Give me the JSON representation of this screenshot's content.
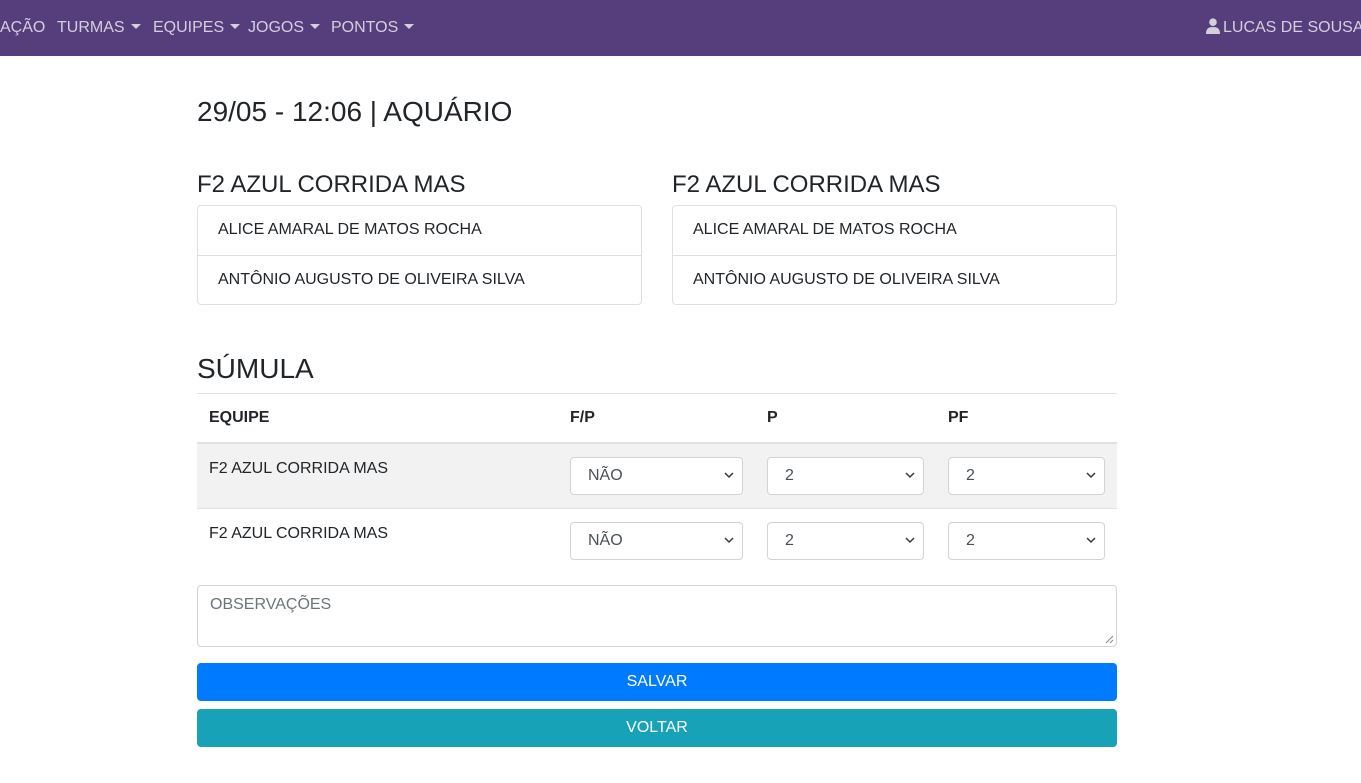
{
  "navbar": {
    "items": [
      {
        "label": "AÇÃO",
        "caret": false
      },
      {
        "label": "TURMAS",
        "caret": true
      },
      {
        "label": "EQUIPES",
        "caret": true
      },
      {
        "label": "JOGOS",
        "caret": true
      },
      {
        "label": "PONTOS",
        "caret": true
      }
    ],
    "user": "LUCAS DE SOUSA A",
    "background": "#563d7c"
  },
  "page_title": "29/05 - 12:06 | AQUÁRIO",
  "teams": [
    {
      "name": "F2 AZUL CORRIDA MAS",
      "members": [
        "ALICE AMARAL DE MATOS ROCHA",
        "ANTÔNIO AUGUSTO DE OLIVEIRA SILVA"
      ]
    },
    {
      "name": "F2 AZUL CORRIDA MAS",
      "members": [
        "ALICE AMARAL DE MATOS ROCHA",
        "ANTÔNIO AUGUSTO DE OLIVEIRA SILVA"
      ]
    }
  ],
  "sumula": {
    "title": "SÚMULA",
    "headers": [
      "EQUIPE",
      "F/P",
      "P",
      "PF"
    ],
    "rows": [
      {
        "team": "F2 AZUL CORRIDA MAS",
        "fp": "NÃO",
        "p": "2",
        "pf": "2"
      },
      {
        "team": "F2 AZUL CORRIDA MAS",
        "fp": "NÃO",
        "p": "2",
        "pf": "2"
      }
    ]
  },
  "observacoes_placeholder": "OBSERVAÇÕES",
  "buttons": {
    "save": "SALVAR",
    "back": "VOLTAR",
    "save_color": "#007bff",
    "back_color": "#17a2b8"
  }
}
